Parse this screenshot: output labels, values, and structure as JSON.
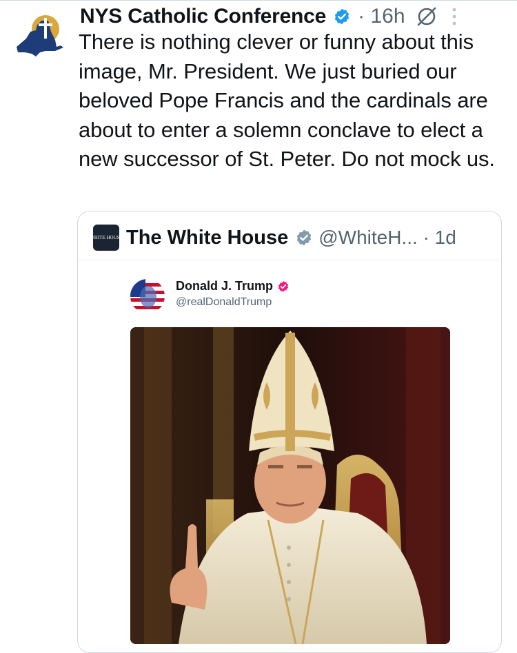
{
  "tweet": {
    "author_name": "NYS Catholic Conference",
    "meta": "· 16h",
    "text": "There is nothing clever or funny about this image, Mr. President. We just buried our beloved Pope Francis and the cardinals are about to enter a solemn conclave to elect a new successor of St. Peter. Do not mock us.",
    "avatar_icon": "new-york-state-map-with-cross-icon",
    "verified_icon": "verified-badge-icon",
    "grok_icon": "grok-icon",
    "more_icon": "more-options-icon"
  },
  "quote": {
    "author_name": "The White House",
    "avatar_text": "WHITE HOUSE",
    "handle_and_time": "@WhiteH... · 1d",
    "badge_icon": "government-verified-badge-icon",
    "inner_post": {
      "author_name": "Donald J. Trump",
      "handle": "@realDonaldTrump",
      "badge_icon": "verified-badge-icon"
    },
    "image_description_icon": "pope-portrait-image"
  },
  "colors": {
    "verified_blue": "#1d9bf0",
    "government_gray": "#829aab",
    "secondary_text": "#536471",
    "trump_badge": "#f91880",
    "border": "#cfd9de"
  }
}
